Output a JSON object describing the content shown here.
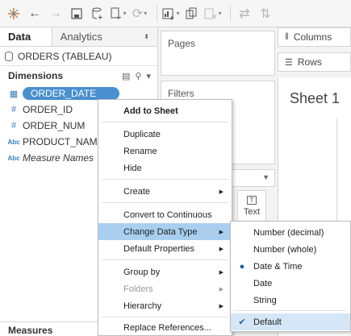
{
  "toolbar": {
    "icons": [
      "tableau-logo-icon",
      "back-arrow-icon",
      "forward-arrow-icon",
      "save-icon",
      "new-datasource-icon",
      "new-worksheet-icon",
      "redo-icon",
      "show-me-icon",
      "duplicate-sheet-icon",
      "clear-sheet-icon",
      "swap-icon",
      "sort-icon"
    ]
  },
  "data_pane": {
    "tab_data": "Data",
    "tab_analytics": "Analytics",
    "datasource_name": "ORDERS (TABLEAU)",
    "dimensions_header": "Dimensions",
    "fields": [
      {
        "type": "date",
        "icon_glyph": "▦",
        "name": "ORDER_DATE"
      },
      {
        "type": "number",
        "icon_glyph": "#",
        "name": "ORDER_ID"
      },
      {
        "type": "number",
        "icon_glyph": "#",
        "name": "ORDER_NUM"
      },
      {
        "type": "string",
        "icon_glyph": "Abc",
        "name": "PRODUCT_NAM"
      },
      {
        "type": "string",
        "icon_glyph": "Abc",
        "name": "Measure Names"
      }
    ],
    "measures_header": "Measures"
  },
  "shelves": {
    "pages": "Pages",
    "filters": "Filters",
    "columns": "Columns",
    "rows": "Rows",
    "text_label": "Text",
    "text_box_glyph": "T"
  },
  "view": {
    "sheet_title": "Sheet 1"
  },
  "context_menu": {
    "items": [
      {
        "label": "Add to Sheet",
        "bold": true
      },
      {
        "label": "Duplicate"
      },
      {
        "label": "Rename"
      },
      {
        "label": "Hide"
      },
      {
        "label": "Create",
        "submenu": true
      },
      {
        "label": "Convert to Continuous"
      },
      {
        "label": "Change Data Type",
        "submenu": true,
        "highlighted": true
      },
      {
        "label": "Default Properties",
        "submenu": true
      },
      {
        "label": "Group by",
        "submenu": true
      },
      {
        "label": "Folders",
        "submenu": true,
        "disabled": true
      },
      {
        "label": "Hierarchy",
        "submenu": true
      },
      {
        "label": "Replace References..."
      }
    ]
  },
  "data_type_submenu": {
    "items": [
      {
        "label": "Number (decimal)"
      },
      {
        "label": "Number (whole)"
      },
      {
        "label": "Date & Time",
        "selected": true
      },
      {
        "label": "Date"
      },
      {
        "label": "String"
      },
      {
        "label": "Default",
        "checked": true
      }
    ]
  },
  "colors": {
    "selected_field": "#4a8fce",
    "menu_highlight": "#a9cff0",
    "submenu_checked": "#d5e7f7"
  }
}
